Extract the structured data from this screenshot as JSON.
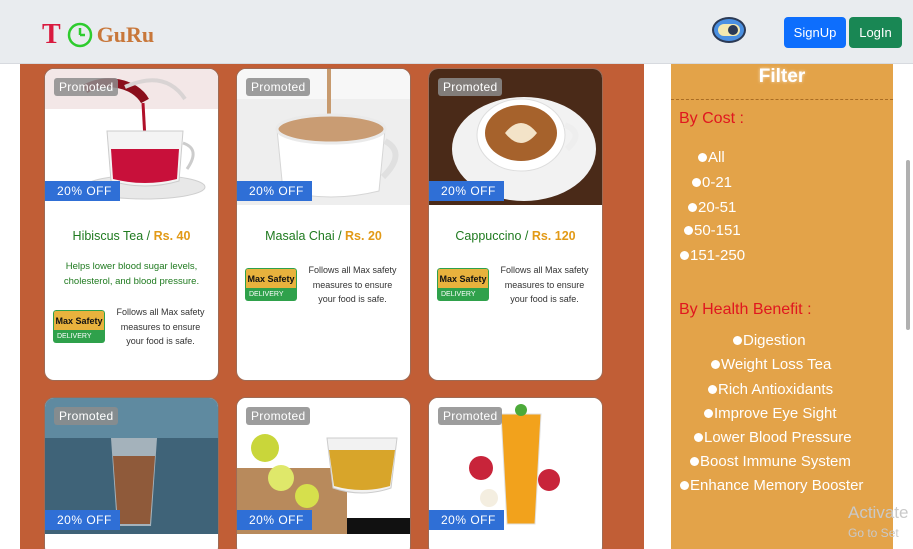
{
  "header": {
    "logo_letter": "T",
    "logo_text": "GuRu",
    "signup_label": "SignUp",
    "login_label": "LogIn"
  },
  "cards": [
    {
      "promoted": "Promoted",
      "discount": "20% OFF",
      "name": "Hibiscus Tea",
      "price": "Rs. 40",
      "desc": "Helps lower blood sugar levels, cholesterol, and blood pressure.",
      "badge_top": "Max Safety",
      "badge_bottom": "DELIVERY",
      "safety": "Follows all Max safety measures to ensure your food is safe."
    },
    {
      "promoted": "Promoted",
      "discount": "20% OFF",
      "name": "Masala Chai",
      "price": "Rs. 20",
      "badge_top": "Max Safety",
      "badge_bottom": "DELIVERY",
      "safety": "Follows all Max safety measures to ensure your food is safe."
    },
    {
      "promoted": "Promoted",
      "discount": "20% OFF",
      "name": "Cappuccino",
      "price": "Rs. 120",
      "badge_top": "Max Safety",
      "badge_bottom": "DELIVERY",
      "safety": "Follows all Max safety measures to ensure your food is safe."
    },
    {
      "promoted": "Promoted",
      "discount": "20% OFF"
    },
    {
      "promoted": "Promoted",
      "discount": "20% OFF"
    },
    {
      "promoted": "Promoted",
      "discount": "20% OFF"
    }
  ],
  "filter": {
    "title": "Filter",
    "cost_heading": "By Cost :",
    "cost_options": [
      "All",
      "0-21",
      "20-51",
      "50-151",
      "151-250"
    ],
    "health_heading": "By Health Benefit :",
    "health_options": [
      "Digestion",
      "Weight Loss Tea",
      "Rich Antioxidants",
      "Improve Eye Sight",
      "Lower Blood Pressure",
      "Boost Immune System",
      "Enhance Memory Booster"
    ]
  },
  "watermark": {
    "line1": "Activate",
    "line2": "Go to Set"
  },
  "colors": {
    "primary": "#0d6efd",
    "success": "#198754",
    "main_bg": "#c15e36",
    "filter_bg": "#e3a349",
    "discount": "#2f6fd6"
  }
}
